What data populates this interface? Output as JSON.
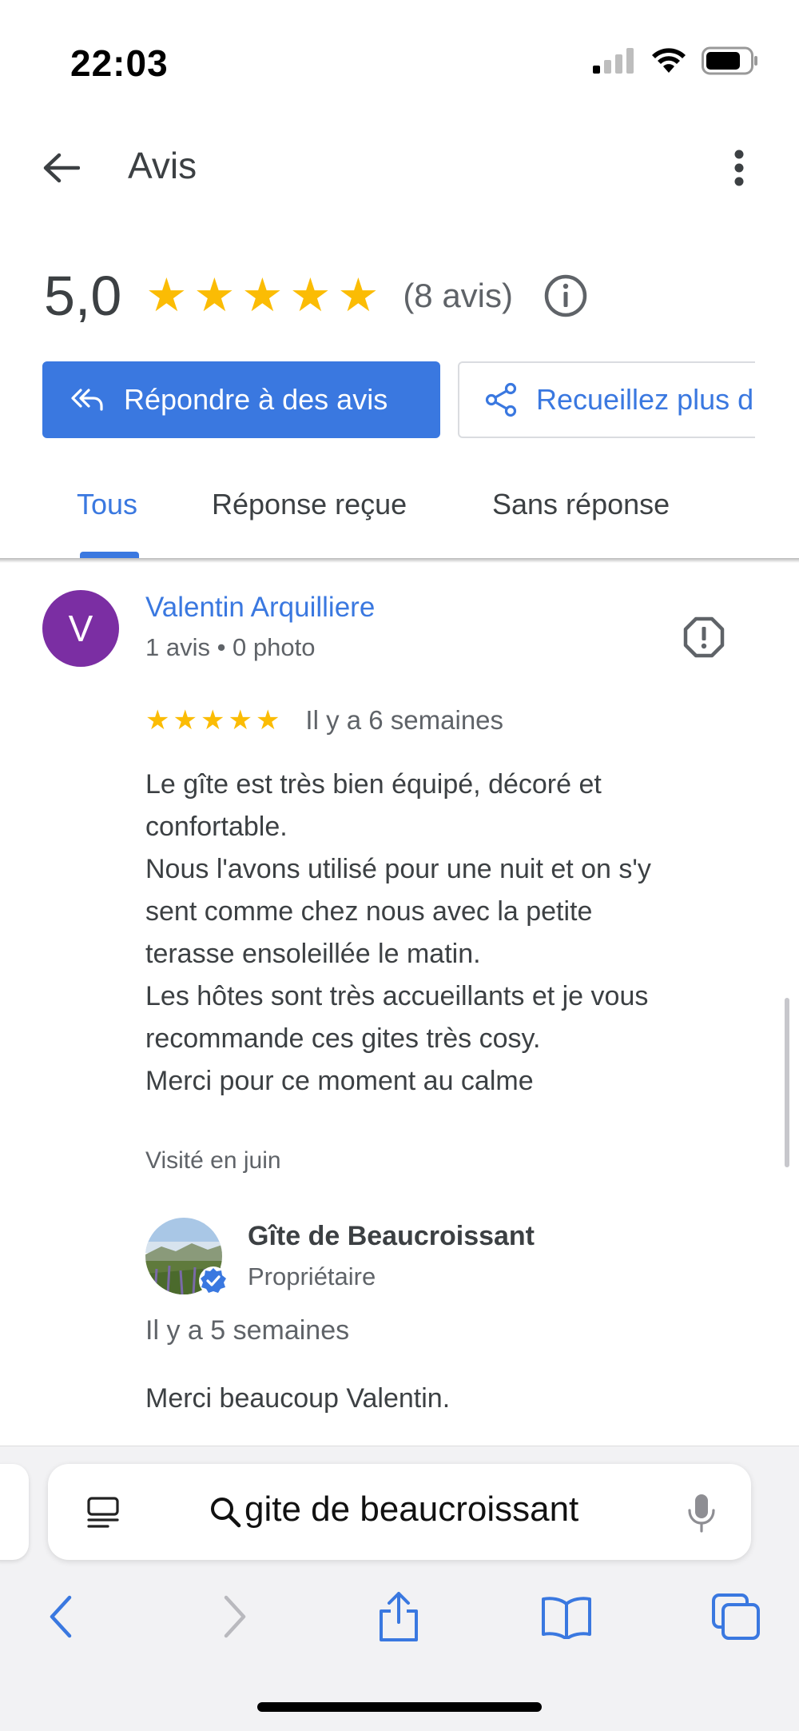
{
  "status_bar": {
    "time": "22:03",
    "signal_icon": "signal-icon",
    "wifi_icon": "wifi-icon",
    "battery_icon": "battery-icon"
  },
  "header": {
    "title": "Avis",
    "back_icon": "arrow-left-icon",
    "more_icon": "more-vertical-icon"
  },
  "summary": {
    "rating": "5,0",
    "stars": 5,
    "count_label": "(8 avis)",
    "info_icon": "info-icon"
  },
  "actions": {
    "reply_label": "Répondre à des avis",
    "collect_label": "Recueillez plus d'avis"
  },
  "tabs": [
    {
      "label": "Tous",
      "active": true
    },
    {
      "label": "Réponse reçue",
      "active": false
    },
    {
      "label": "Sans réponse",
      "active": false
    }
  ],
  "review": {
    "avatar_letter": "V",
    "avatar_color": "#7b2ea3",
    "author": "Valentin Arquilliere",
    "meta": "1 avis • 0 photo",
    "stars": 5,
    "date": "Il y a 6 semaines",
    "text_lines": [
      "Le gîte est très bien équipé, décoré et",
      "confortable.",
      "Nous l'avons utilisé pour une nuit et on s'y",
      "sent comme chez nous avec la petite",
      "terasse ensoleillée le matin.",
      "Les hôtes sont très accueillants et je vous",
      "recommande ces gites très cosy.",
      "Merci pour ce moment au calme"
    ],
    "visited": "Visité en juin",
    "owner_reply": {
      "name": "Gîte de Beaucroissant",
      "role": "Propriétaire",
      "date": "Il y a 5 semaines",
      "text": "Merci beaucoup Valentin."
    }
  },
  "browser": {
    "address": "gite de beaucroissant",
    "toolbar_icons": [
      "back-icon",
      "forward-icon",
      "share-icon",
      "bookmarks-icon",
      "tabs-icon"
    ]
  },
  "colors": {
    "accent": "#3a78e0",
    "star": "#fbbc04"
  }
}
